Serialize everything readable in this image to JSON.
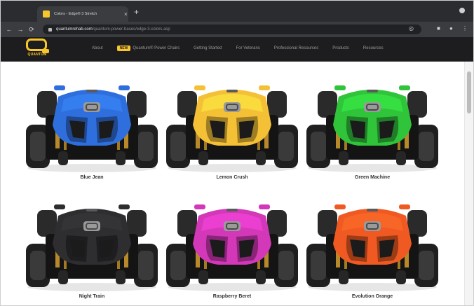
{
  "browser": {
    "tab_title": "Colors - Edge® 3 Stretch",
    "tab_close": "×",
    "new_tab": "+",
    "url_host": "quantumrehab.com",
    "url_path": "/quantum-power-bases/edge-3-colors.asp",
    "back": "←",
    "forward": "→",
    "reload": "⟳"
  },
  "site": {
    "logo_text": "QUANTUM",
    "nav": [
      {
        "label": "About"
      },
      {
        "label": "Quantum® Power Chairs",
        "badge": "NEW"
      },
      {
        "label": "Getting Started"
      },
      {
        "label": "For Veterans"
      },
      {
        "label": "Professional Resources"
      },
      {
        "label": "Products"
      },
      {
        "label": "Resources"
      }
    ]
  },
  "colors": {
    "accent": "#f7c52c",
    "header_bg": "#1d1d1f"
  },
  "products": [
    {
      "name": "Blue Jean",
      "color": "#2f6fdd"
    },
    {
      "name": "Lemon Crush",
      "color": "#f4c136"
    },
    {
      "name": "Green Machine",
      "color": "#2fc43a"
    },
    {
      "name": "Night Train",
      "color": "#2e2e31"
    },
    {
      "name": "Raspberry Beret",
      "color": "#d338b8"
    },
    {
      "name": "Evolution Orange",
      "color": "#f05a22"
    }
  ]
}
